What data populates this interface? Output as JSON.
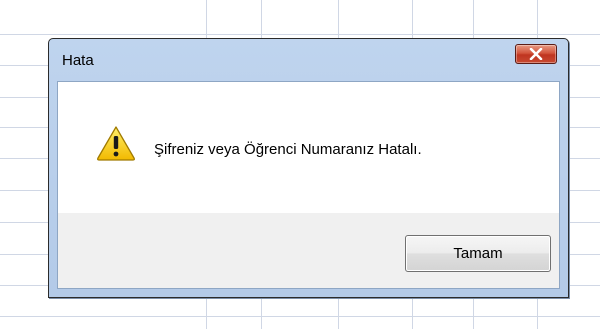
{
  "dialog": {
    "title": "Hata",
    "message": "Şifreniz veya Öğrenci Numaranız Hatalı.",
    "ok_label": "Tamam",
    "icon": "warning-icon",
    "close_icon": "close-icon"
  },
  "colors": {
    "title_bar": "#bfd4ee",
    "close_button": "#c84a32",
    "content_background": "#ffffff",
    "footer_background": "#f0f0f0",
    "warning_yellow": "#f5c800"
  }
}
